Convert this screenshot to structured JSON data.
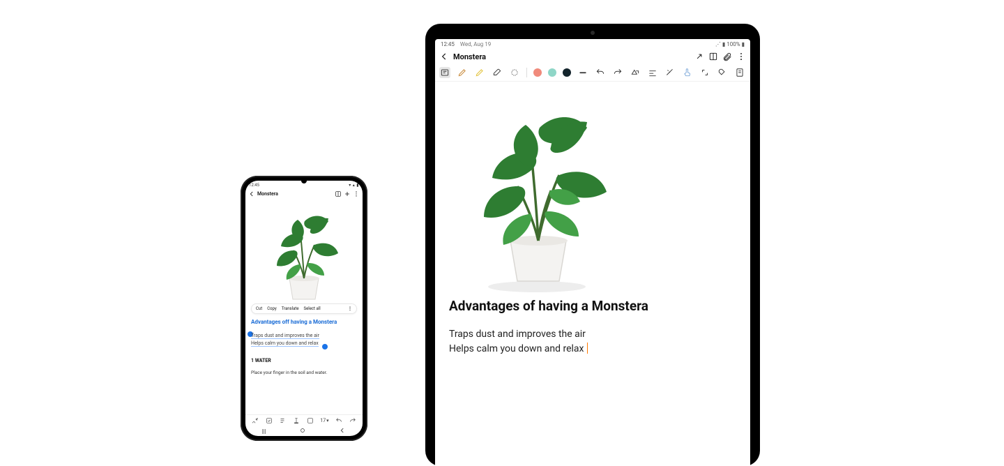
{
  "phone": {
    "status_time": "12:45",
    "title": "Monstera",
    "context_menu": {
      "cut": "Cut",
      "copy": "Copy",
      "translate": "Translate",
      "select_all": "Select all"
    },
    "sel_title": "Advantages off having a Monstera",
    "sel_line_a": "Traps dust and improves the air",
    "sel_line_b": "Helps calm you down and relax",
    "section_header": "1 WATER",
    "body_text": "Place your finger in the soil and water.",
    "toolbar_font_size": "17"
  },
  "tablet": {
    "status_time": "12:45",
    "status_date": "Wed, Aug 19",
    "battery_text": "100%",
    "title": "Monstera",
    "heading": "Advantages of having a Monstera",
    "line_a": "Traps dust and improves the air",
    "line_b": "Helps calm you down and relax",
    "colors": {
      "swatch1": "#f08a7b",
      "swatch2": "#8fd6c7",
      "swatch3": "#13242c"
    }
  }
}
